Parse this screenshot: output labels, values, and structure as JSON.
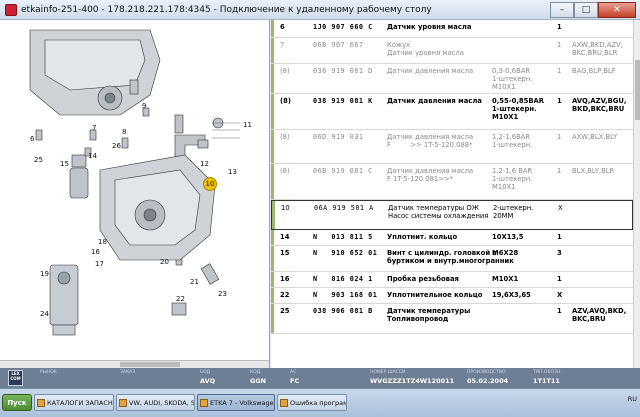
{
  "window": {
    "title": "etkainfo-251-400 - 178.218.221.178:4345 - Подключение к удаленному рабочему столу",
    "minimize": "–",
    "maximize": "□",
    "close": "✕"
  },
  "diagram": {
    "callouts": [
      "6",
      "7",
      "8",
      "9",
      "11",
      "12",
      "10",
      "13",
      "14",
      "15",
      "16",
      "17",
      "18",
      "19",
      "20",
      "21",
      "22",
      "23",
      "24",
      "25",
      "26"
    ],
    "highlighted": "10"
  },
  "parts": {
    "rows": [
      {
        "pos": "6",
        "pno": "1J0 907 660 C",
        "name": "Датчик уровня масла",
        "note": "",
        "qty": "1",
        "model": "",
        "style": "bold"
      },
      {
        "pos": "7",
        "pno": "06B 907 667",
        "name": "Кожух\nДатчик уровня масла",
        "note": "",
        "qty": "1",
        "model": "AXW,BKD,AZV,\nBKC,BRU,BLR",
        "style": "dim"
      },
      {
        "pos": "(8)",
        "pno": "036 919 081 D",
        "name": "Датчик давления масла",
        "note": "0,3-0,6BAR\n1-штекерн.\nM10X1",
        "qty": "1",
        "model": "BAG,BLP,BLF",
        "style": "dim"
      },
      {
        "pos": "(8)",
        "pno": "038 919 081 K",
        "name": "Датчик давления масла",
        "note": "0,55-0,85BAR\n1-штекерн.\nM10X1",
        "qty": "1",
        "model": "AVQ,AZV,BGU,\nBKD,BKC,BRU",
        "style": "bold"
      },
      {
        "pos": "(8)",
        "pno": "06D 919 031",
        "name": "Датчик давления масла\nF         >> 1T-5-120 088*",
        "note": "1,2-1,6BAR\n1-штекерн.",
        "qty": "1",
        "model": "AXW,BLX,BLY",
        "style": "dim"
      },
      {
        "pos": "(8)",
        "pno": "06B 919 081 C",
        "name": "Датчик давления масла\nF 1T-5-120 081>>*",
        "note": "1,2-1,6 BAR\n1-штекерн.\nM10X1",
        "qty": "1",
        "model": "BLX,BLY,BLR",
        "style": "dim"
      },
      {
        "pos": "10",
        "pno": "06A 919 501 A",
        "name": "Датчик температуры ОЖ\nНасос системы охлаждения",
        "note": "2-штекерн.\n20MM",
        "qty": "X",
        "model": "",
        "style": "sel"
      },
      {
        "pos": "14",
        "pno": "N   013 811 5",
        "name": "Уплотнит. кольцо",
        "note": "10X13,5",
        "qty": "1",
        "model": "",
        "style": "bold"
      },
      {
        "pos": "15",
        "pno": "N   910 652 01",
        "name": "Винт с цилиндр. головкой с\nбуртиком и внутр.многогранник",
        "note": "M6X28",
        "qty": "3",
        "model": "",
        "style": "bold"
      },
      {
        "pos": "16",
        "pno": "N   016 024 1",
        "name": "Пробка резьбовая",
        "note": "M10X1",
        "qty": "1",
        "model": "",
        "style": "bold"
      },
      {
        "pos": "22",
        "pno": "N   903 168 01",
        "name": "Уплотнительное кольцо",
        "note": "19,6X3,65",
        "qty": "X",
        "model": "",
        "style": "bold"
      },
      {
        "pos": "25",
        "pno": "038 906 081 B",
        "name": "Датчик температуры\nТопливопровод",
        "note": "",
        "qty": "1",
        "model": "AZV,AVQ,BKD,\nBKC,BRU",
        "style": "bold"
      }
    ]
  },
  "infobar": {
    "logo": "LEX\nCOM",
    "fields": [
      {
        "label": "РЫНОК",
        "value": ""
      },
      {
        "label": "ЗАКАЗ",
        "value": ""
      },
      {
        "label": "БОД",
        "value": "AVQ"
      },
      {
        "label": "КОД",
        "value": "GGN"
      },
      {
        "label": "АС",
        "value": "FC"
      },
      {
        "label": "НОМЕР ШАССИ",
        "value": "WVGZZZ1TZ4W120011"
      },
      {
        "label": "ПРОИЗВОДСТВО",
        "value": "05.02.2004"
      },
      {
        "label": "ТИП ОБОЗН.",
        "value": "1T1T11"
      }
    ]
  },
  "taskbar": {
    "start": "Пуск",
    "tasks": [
      "КАТАЛОГИ ЗАПАСНЫХ ...",
      "VW, AUDI, SKODA, SEAT",
      "ETKA 7 - Volkswagen",
      "Ошибка программы"
    ],
    "active": 2,
    "tray": "RU"
  },
  "colors": {
    "accent_mark": "#9fb86f",
    "highlight_callout": "#f2c200"
  }
}
